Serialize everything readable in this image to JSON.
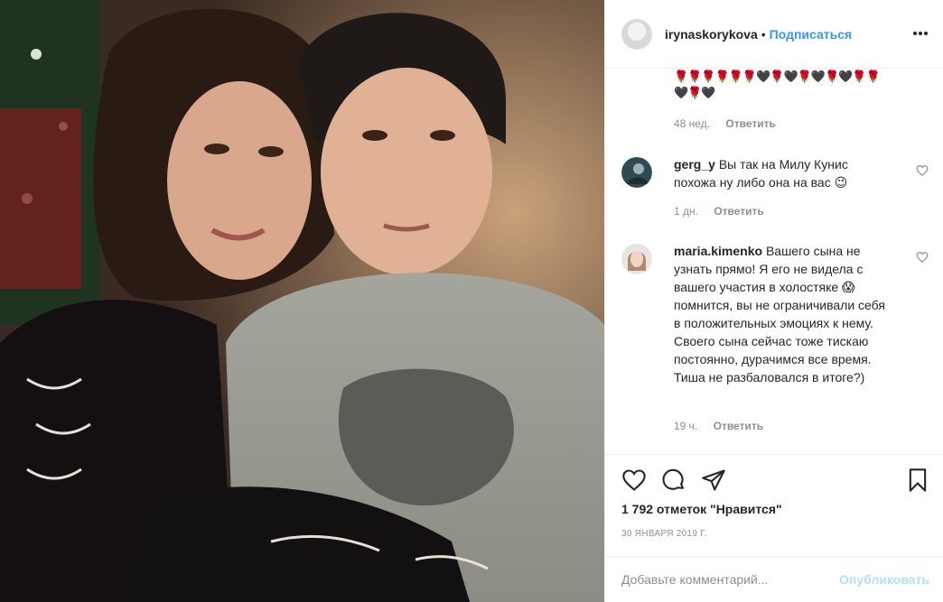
{
  "header": {
    "username": "irynaskorykova",
    "dot": "•",
    "follow_label": "Подписаться"
  },
  "comments": {
    "emoji_row_1": "🌹🌹🌹🌹🌹🌹🖤🌹🖤🌹🖤🌹🖤🌹🌹",
    "emoji_row_2": "🖤🌹🖤",
    "first": {
      "time": "48 нед.",
      "reply": "Ответить"
    },
    "items": [
      {
        "username": "gerg_y",
        "text": "Вы так на Милу Кунис похожа ну либо она на вас 😉",
        "time": "1 дн.",
        "reply": "Ответить"
      },
      {
        "username": "maria.kimenko",
        "text": "Вашего сына не узнать прямо! Я его не видела с вашего участия в холостяке 😱 помнится, вы не ограничивали себя в положительных эмоциях к нему. Своего сына сейчас тоже тискаю постоянно, дурачимся все время. Тиша не разбаловался в итоге?)",
        "time": "19 ч.",
        "reply": "Ответить"
      }
    ]
  },
  "actions": {
    "likes": "1 792 отметок \"Нравится\"",
    "date": "30 ЯНВАРЯ 2019 Г."
  },
  "add_comment": {
    "placeholder": "Добавьте комментарий...",
    "publish": "Опубликовать"
  },
  "colors": {
    "link": "#3897f0",
    "muted": "#8e8e8e",
    "publish_disabled": "#b2dffc",
    "border": "#efefef"
  }
}
